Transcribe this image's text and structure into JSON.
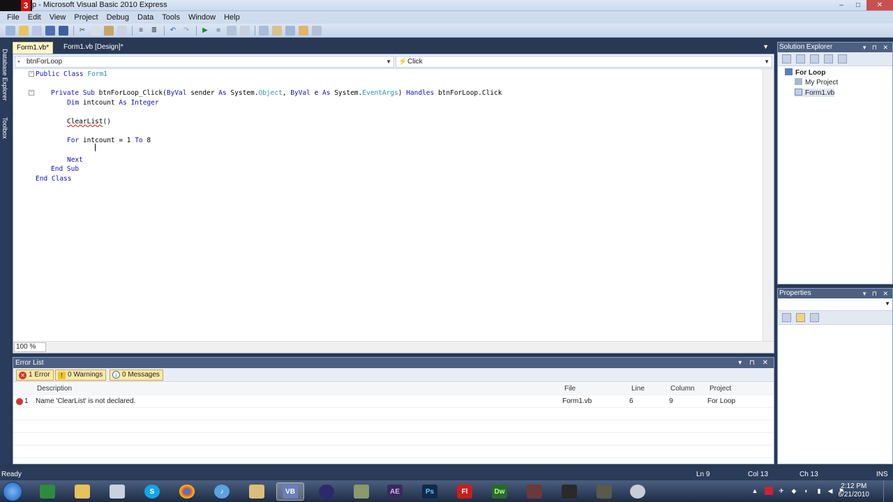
{
  "window": {
    "title": "p - Microsoft Visual Basic 2010 Express",
    "logo_letter": "3",
    "controls": [
      "–",
      "□",
      "✕"
    ]
  },
  "menu": [
    "File",
    "Edit",
    "View",
    "Project",
    "Debug",
    "Data",
    "Tools",
    "Window",
    "Help"
  ],
  "toolbar_icons": [
    "new-project-icon",
    "open-icon",
    "add-item-icon",
    "save-icon",
    "save-all-icon",
    "cut-icon",
    "copy-icon",
    "paste-icon",
    "find-icon",
    "comment-icon",
    "uncomment-icon",
    "undo-icon",
    "redo-icon",
    "start-debugging-icon",
    "stop-icon",
    "step-icon",
    "breakpoint-icon",
    "solution-explorer-icon",
    "properties-icon",
    "object-browser-icon",
    "toolbox-icon",
    "extensions-icon"
  ],
  "side_tabs": [
    "Database Explorer",
    "Toolbox"
  ],
  "doc_tabs": [
    {
      "label": "Form1.vb*",
      "active": true
    },
    {
      "label": "Form1.vb [Design]*",
      "active": false
    }
  ],
  "nav": {
    "object": "btnForLoop",
    "event": "Click"
  },
  "code": {
    "l1_a": "Public Class ",
    "l1_b": "Form1",
    "l2_a": "Private Sub",
    "l2_b": " btnForLoop_Click(",
    "l2_c": "ByVal",
    "l2_d": " sender ",
    "l2_e": "As",
    "l2_f": " System.",
    "l2_g": "Object",
    "l2_h": ", ",
    "l2_i": "ByVal",
    "l2_j": " e ",
    "l2_k": "As",
    "l2_l": " System.",
    "l2_m": "EventArgs",
    "l2_n": ") ",
    "l2_o": "Handles",
    "l2_p": " btnForLoop.Click",
    "l3_a": "Dim",
    "l3_b": " intcount ",
    "l3_c": "As Integer",
    "l4_a": "ClearList",
    "l4_b": "()",
    "l5_a": "For",
    "l5_b": " intcount = 1 ",
    "l5_c": "To",
    "l5_d": " 8",
    "l6": "Next",
    "l7": "End Sub",
    "l8": "End Class"
  },
  "zoom": "100 %",
  "error_list": {
    "title": "Error List",
    "filters": {
      "errors": "1 Error",
      "warnings": "0 Warnings",
      "messages": "0 Messages"
    },
    "columns": [
      "Description",
      "File",
      "Line",
      "Column",
      "Project"
    ],
    "rows": [
      {
        "num": "1",
        "description": "Name 'ClearList' is not declared.",
        "file": "Form1.vb",
        "line": "6",
        "column": "9",
        "project": "For Loop"
      }
    ]
  },
  "solution_explorer": {
    "title": "Solution Explorer",
    "items": [
      "For Loop",
      "My Project",
      "Form1.vb"
    ]
  },
  "properties": {
    "title": "Properties"
  },
  "status": {
    "text": "Ready",
    "ln": "Ln 9",
    "col": "Col 13",
    "ch": "Ch 13",
    "mode": "INS"
  },
  "taskbar": {
    "apps": [
      "Explorer",
      "Folder",
      "Drive",
      "Skype",
      "Chrome",
      "iTunes",
      "Visio",
      "VB",
      "Eclipse",
      "Flash Builder",
      "AE",
      "Ps",
      "Fl",
      "Dw",
      "Archive",
      "Gimp",
      "Game",
      "Disc"
    ],
    "time": "2:12 PM",
    "date": "6/21/2010"
  },
  "colors": {
    "keyword": "#1010c8",
    "type": "#2b91af",
    "error": "#e01010",
    "chrome": "#293955"
  }
}
